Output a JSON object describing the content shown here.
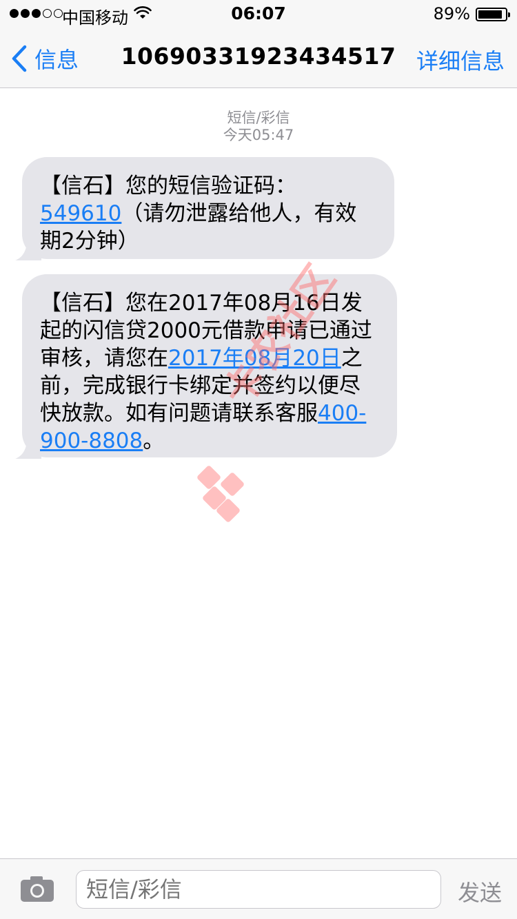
{
  "status_bar": {
    "carrier": "中国移动",
    "time": "06:07",
    "battery_text": "89%",
    "battery_level": 0.89,
    "signal_bars_filled": 3,
    "signal_bars_total": 5
  },
  "nav": {
    "back_label": "信息",
    "title": "10690331923434517",
    "detail_label": "详细信息"
  },
  "thread": {
    "message_type": "短信/彩信",
    "timestamp": "今天05:47",
    "messages": [
      {
        "part1": "【信石】您的短信验证码：",
        "code_link": "549610",
        "part2": "（请勿泄露给他人，有效期2分钟）"
      },
      {
        "part1": "【信石】您在2017年08月16日发起的闪信贷2000元借款申请已通过审核，请您在",
        "date_link": "2017年08月20日",
        "part2": "之前，完成银行卡绑定并签约以便尽快放款。如有问题请联系客服",
        "phone_link": "400-900-8808",
        "part3": "。"
      }
    ]
  },
  "watermark": {
    "text": "卡农社区"
  },
  "composer": {
    "placeholder": "短信/彩信",
    "send_label": "发送"
  },
  "colors": {
    "accent": "#1a7ef5",
    "bubble_bg": "#e5e5ea",
    "meta_gray": "#8e8e93",
    "bar_bg": "#f7f7f7"
  }
}
